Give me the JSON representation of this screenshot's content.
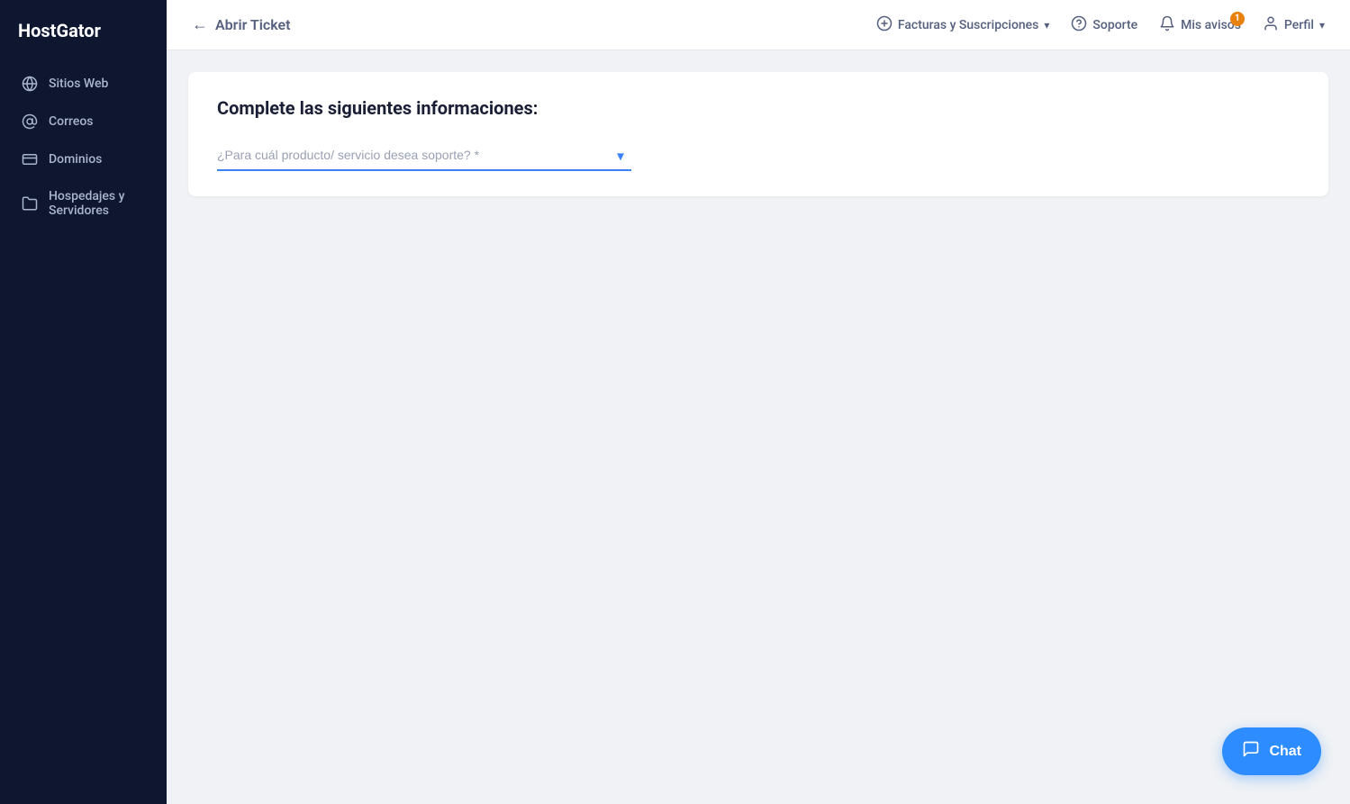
{
  "sidebar": {
    "logo": "HostGator",
    "items": [
      {
        "id": "sitios-web",
        "label": "Sitios Web",
        "icon": "globe"
      },
      {
        "id": "correos",
        "label": "Correos",
        "icon": "at"
      },
      {
        "id": "dominios",
        "label": "Dominios",
        "icon": "card"
      },
      {
        "id": "hospedajes",
        "label": "Hospedajes y Servidores",
        "icon": "folder"
      }
    ]
  },
  "topnav": {
    "back_label": "Abrir Ticket",
    "facturas_label": "Facturas y Suscripciones",
    "soporte_label": "Soporte",
    "avisos_label": "Mis avisos",
    "avisos_badge": "1",
    "perfil_label": "Perfil"
  },
  "main": {
    "card_title": "Complete las siguientes informaciones:",
    "select_placeholder": "¿Para cuál producto/ servicio desea soporte? *"
  },
  "chat": {
    "label": "Chat",
    "icon": "chat-icon"
  }
}
